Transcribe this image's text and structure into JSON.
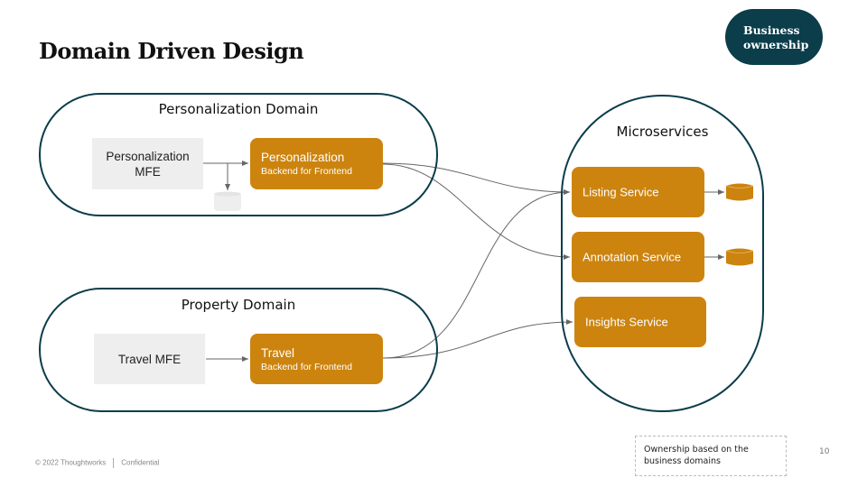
{
  "title": "Domain Driven Design",
  "badge": {
    "line1": "Business",
    "line2": "ownership"
  },
  "domains": [
    {
      "title": "Personalization Domain",
      "mfe": {
        "line1": "Personalization",
        "line2": "MFE"
      },
      "bff": {
        "title": "Personalization",
        "subtitle": "Backend for Frontend"
      }
    },
    {
      "title": "Property Domain",
      "mfe": {
        "line1": "Travel MFE",
        "line2": ""
      },
      "bff": {
        "title": "Travel",
        "subtitle": "Backend for Frontend"
      }
    }
  ],
  "microservices": {
    "title": "Microservices",
    "services": [
      "Listing Service",
      "Annotation Service",
      "Insights Service"
    ]
  },
  "colors": {
    "accent": "#cc840f",
    "brand": "#0b3d4a",
    "mfe_bg": "#eeeeee",
    "arrow": "#666666"
  },
  "note": {
    "line1": "Ownership based on the",
    "line2": "business domains"
  },
  "footer": {
    "copyright": "© 2022 Thoughtworks",
    "confidential": "Confidential",
    "page": "10"
  }
}
